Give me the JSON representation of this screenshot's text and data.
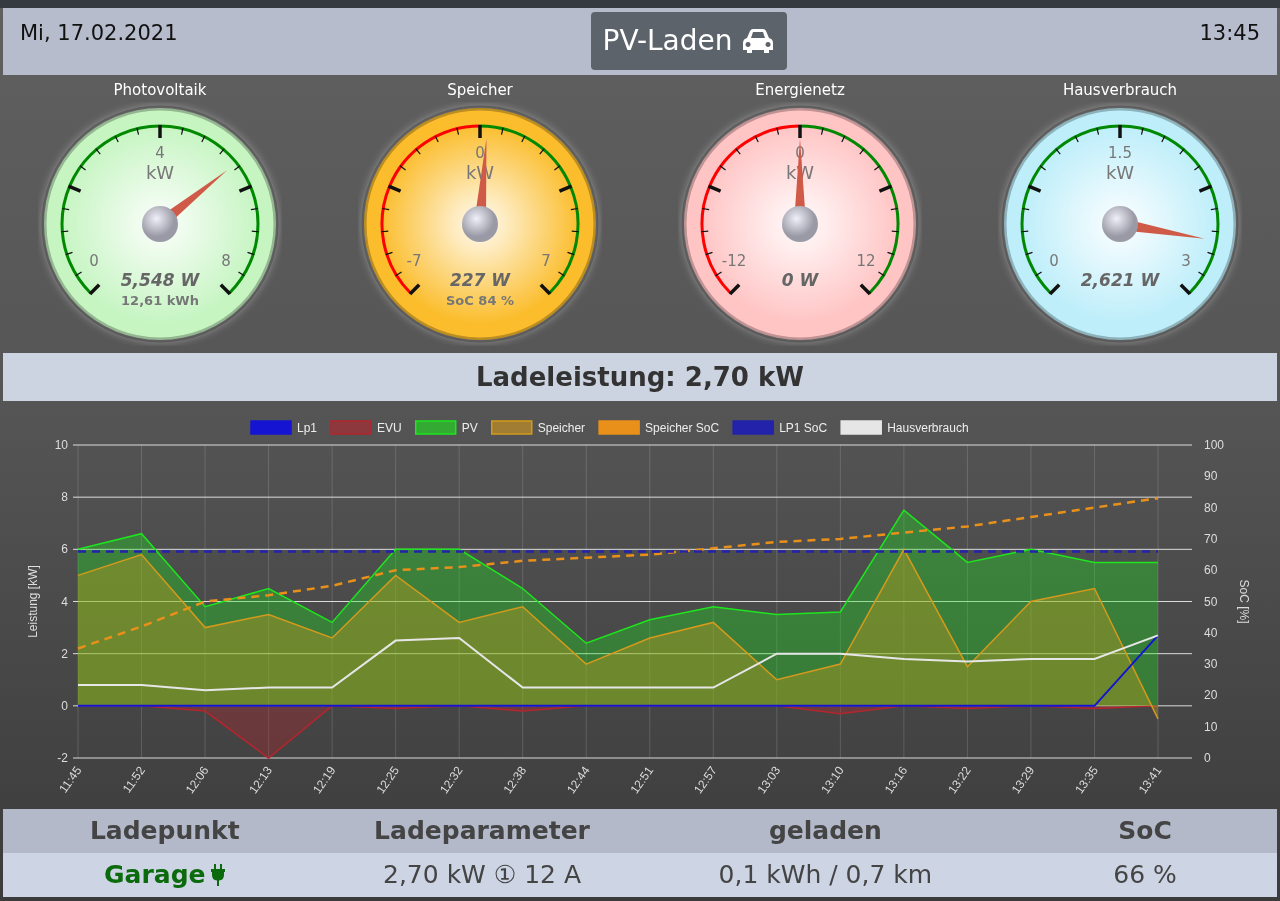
{
  "header": {
    "date": "Mi, 17.02.2021",
    "title": "PV-Laden",
    "time": "13:45"
  },
  "gauges": [
    {
      "title": "Photovoltaik",
      "kind": "unipolar",
      "color": "#c6f5c2",
      "min": "0",
      "mid": "4",
      "max": "8",
      "unit": "kW",
      "level": 0.69,
      "value": "5,548 W",
      "sub": "12,61 kWh"
    },
    {
      "title": "Speicher",
      "kind": "bidirectional",
      "color": "#fbbd2c",
      "min": "-7",
      "mid": "0",
      "max": "7",
      "unit": "kW",
      "level": 0.516,
      "value": "227 W",
      "sub": "SoC 84 %"
    },
    {
      "title": "Energienetz",
      "kind": "bidirectional",
      "color": "#ffc4c4",
      "min": "-12",
      "mid": "0",
      "max": "12",
      "unit": "kW",
      "level": 0.5,
      "value": "0 W"
    },
    {
      "title": "Hausverbrauch",
      "kind": "unipolar",
      "color": "#bdeefa",
      "min": "0",
      "mid": "1.5",
      "max": "3",
      "unit": "kW",
      "level": 0.87,
      "value": "2,621 W"
    }
  ],
  "charging_power": "Ladeleistung: 2,70 kW",
  "chart": {
    "chart_data": {
      "type": "line",
      "grid": true,
      "legend": "top",
      "ylabel": "Leistung [kW]",
      "y2label": "SoC [%]",
      "categories": [
        "11:45",
        "11:52",
        "12:06",
        "12:13",
        "12:19",
        "12:25",
        "12:32",
        "12:38",
        "12:44",
        "12:51",
        "12:57",
        "13:03",
        "13:10",
        "13:16",
        "13:22",
        "13:29",
        "13:35",
        "13:41"
      ],
      "ylim": [
        -2,
        10
      ],
      "yticks": [
        -2,
        0,
        2,
        4,
        6,
        8,
        10
      ],
      "y2lim": [
        0,
        100
      ],
      "y2ticks": [
        0,
        10,
        20,
        30,
        40,
        50,
        60,
        70,
        80,
        90,
        100
      ],
      "series": [
        {
          "name": "Lp1",
          "color": "#1414d2",
          "type": "line",
          "values": [
            0,
            0,
            0,
            0,
            0,
            0,
            0,
            0,
            0,
            0,
            0,
            0,
            0,
            0,
            0,
            0,
            0,
            2.7
          ]
        },
        {
          "name": "EVU",
          "color": "#b3262e",
          "type": "area",
          "values": [
            0,
            0,
            -0.2,
            -2,
            0,
            -0.1,
            0,
            -0.2,
            0,
            0,
            0,
            0,
            -0.3,
            0,
            -0.1,
            0,
            -0.1,
            0
          ]
        },
        {
          "name": "PV",
          "color": "#1ee61e",
          "type": "area",
          "values": [
            6,
            6.6,
            3.8,
            4.5,
            3.2,
            6,
            6,
            4.5,
            2.4,
            3.3,
            3.8,
            3.5,
            3.6,
            7.5,
            5.5,
            6,
            5.5,
            5.5
          ]
        },
        {
          "name": "Speicher",
          "color": "#d49a1c",
          "type": "area",
          "values": [
            5,
            5.8,
            3,
            3.5,
            2.6,
            5,
            3.2,
            3.8,
            1.6,
            2.6,
            3.2,
            1,
            1.6,
            6,
            1.5,
            4,
            4.5,
            -0.5
          ]
        },
        {
          "name": "Speicher SoC",
          "color": "#e8901a",
          "type": "line",
          "axis": "y2",
          "line_style": "dashed",
          "values": [
            35,
            42,
            50,
            52,
            55,
            60,
            61,
            63,
            64,
            65,
            67,
            69,
            70,
            72,
            74,
            77,
            80,
            83
          ]
        },
        {
          "name": "LP1 SoC",
          "color": "#2222aa",
          "type": "line",
          "axis": "y2",
          "line_style": "dashed",
          "values": [
            66,
            66,
            66,
            66,
            66,
            66,
            66,
            66,
            66,
            66,
            66,
            66,
            66,
            66,
            66,
            66,
            66,
            66
          ]
        },
        {
          "name": "Hausverbrauch",
          "color": "#e6e6e6",
          "type": "line",
          "values": [
            0.8,
            0.8,
            0.6,
            0.7,
            0.7,
            2.5,
            2.6,
            0.7,
            0.7,
            0.7,
            0.7,
            2,
            2,
            1.8,
            1.7,
            1.8,
            1.8,
            2.7
          ]
        }
      ]
    }
  },
  "table": {
    "columns": [
      "Ladepunkt",
      "Ladeparameter",
      "geladen",
      "SoC"
    ],
    "rows": [
      {
        "cells": [
          "Garage",
          "2,70 kW ① 12 A",
          "0,1 kWh / 0,7 km",
          "66 %"
        ]
      }
    ]
  }
}
